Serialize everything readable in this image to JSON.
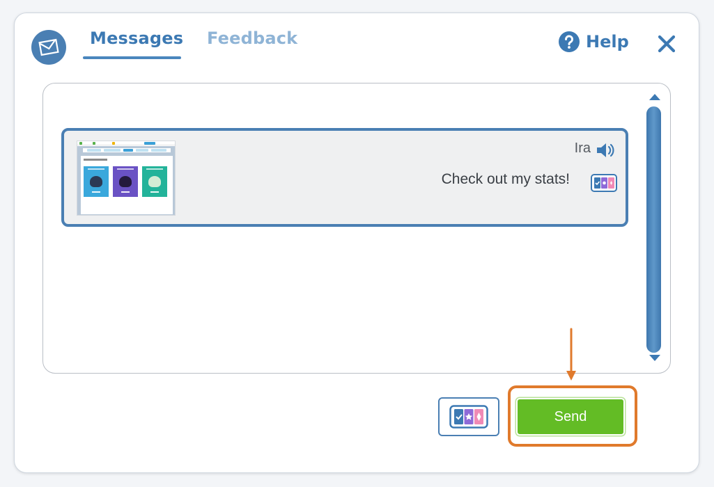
{
  "tabs": [
    {
      "label": "Messages",
      "active": true
    },
    {
      "label": "Feedback",
      "active": false
    }
  ],
  "help": {
    "label": "Help",
    "icon": "question-circle-icon"
  },
  "close": {
    "icon": "close-icon"
  },
  "message": {
    "sender": "Ira",
    "text": "Check out my stats!",
    "attachment": "screenshot-thumbnail"
  },
  "actions": {
    "send_label": "Send",
    "cards_icon": "reward-cards-icon"
  },
  "colors": {
    "primary": "#3c79b3",
    "tab_inactive": "#8fb4d6",
    "send": "#63bc25",
    "highlight": "#e07a2c",
    "card_bg": "#eff0f1"
  }
}
